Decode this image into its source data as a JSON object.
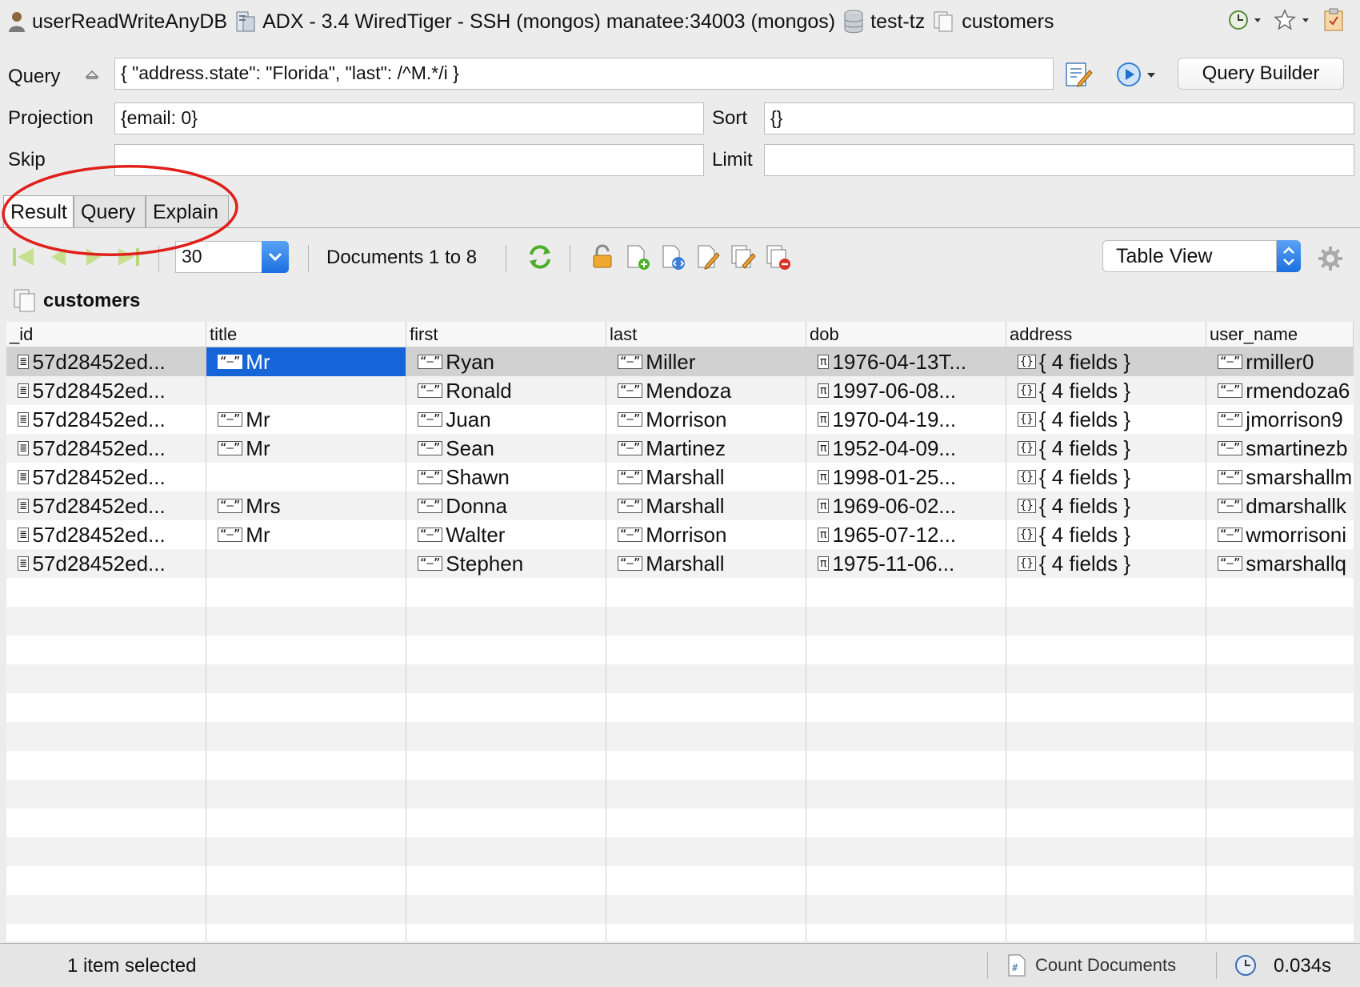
{
  "breadcrumb": {
    "user": "userReadWriteAnyDB",
    "server": "ADX - 3.4 WiredTiger - SSH (mongos) manatee:34003 (mongos)",
    "database": "test-tz",
    "collection": "customers"
  },
  "query_form": {
    "query_label": "Query",
    "query_value": "{ \"address.state\": \"Florida\", \"last\": /^M.*/i }",
    "projection_label": "Projection",
    "projection_value": "{email: 0}",
    "sort_label": "Sort",
    "sort_value": "{}",
    "skip_label": "Skip",
    "skip_value": "",
    "limit_label": "Limit",
    "limit_value": "",
    "query_builder_label": "Query Builder"
  },
  "tabs": [
    {
      "label": "Result",
      "active": true
    },
    {
      "label": "Query",
      "active": false
    },
    {
      "label": "Explain",
      "active": false
    }
  ],
  "toolbar": {
    "page_size": "30",
    "documents_text": "Documents 1 to 8",
    "view_mode": "Table View"
  },
  "collection_title": "customers",
  "table": {
    "columns": [
      "_id",
      "title",
      "first",
      "last",
      "dob",
      "address",
      "user_name"
    ],
    "rows": [
      [
        "57d28452ed...",
        "Mr",
        "Ryan",
        "Miller",
        "1976-04-13T...",
        "{ 4 fields }",
        "rmiller0"
      ],
      [
        "57d28452ed...",
        "",
        "Ronald",
        "Mendoza",
        "1997-06-08...",
        "{ 4 fields }",
        "rmendoza6"
      ],
      [
        "57d28452ed...",
        "Mr",
        "Juan",
        "Morrison",
        "1970-04-19...",
        "{ 4 fields }",
        "jmorrison9"
      ],
      [
        "57d28452ed...",
        "Mr",
        "Sean",
        "Martinez",
        "1952-04-09...",
        "{ 4 fields }",
        "smartinezb"
      ],
      [
        "57d28452ed...",
        "",
        "Shawn",
        "Marshall",
        "1998-01-25...",
        "{ 4 fields }",
        "smarshallm"
      ],
      [
        "57d28452ed...",
        "Mrs",
        "Donna",
        "Marshall",
        "1969-06-02...",
        "{ 4 fields }",
        "dmarshallk"
      ],
      [
        "57d28452ed...",
        "Mr",
        "Walter",
        "Morrison",
        "1965-07-12...",
        "{ 4 fields }",
        "wmorrisoni"
      ],
      [
        "57d28452ed...",
        "",
        "Stephen",
        "Marshall",
        "1975-11-06...",
        "{ 4 fields }",
        "smarshallq"
      ]
    ]
  },
  "status": {
    "selection": "1 item selected",
    "count_label": "Count Documents",
    "elapsed": "0.034s"
  },
  "colors": {
    "selection_blue": "#1565d8",
    "annotation_red": "#e0201b"
  }
}
